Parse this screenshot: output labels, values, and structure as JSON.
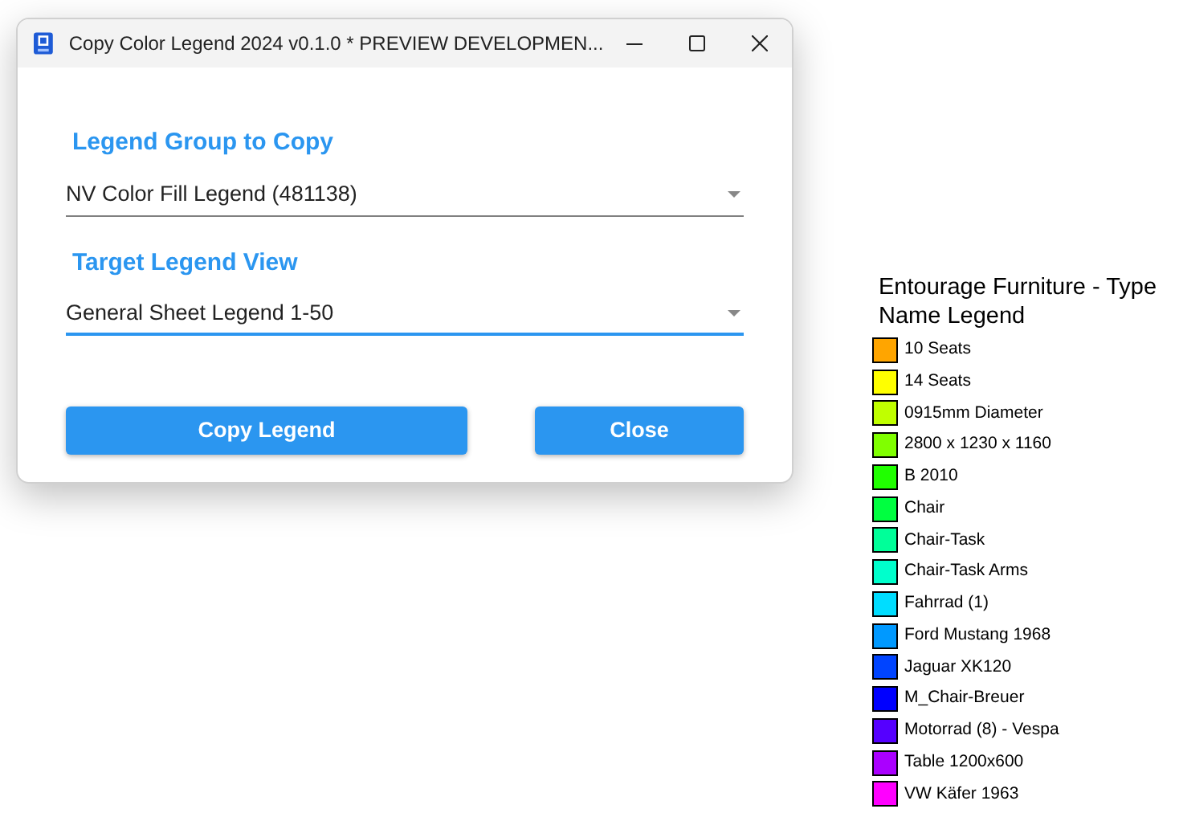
{
  "window": {
    "title": "Copy Color Legend 2024 v0.1.0 * PREVIEW DEVELOPMEN..."
  },
  "fields": [
    {
      "label": "Legend Group to Copy",
      "value": "NV Color Fill Legend (481138)",
      "focused": false
    },
    {
      "label": "Target Legend View",
      "value": "General Sheet Legend 1-50",
      "focused": true
    }
  ],
  "buttons": [
    "Copy Legend",
    "Close"
  ],
  "legend": {
    "title": "Entourage Furniture - Type Name Legend",
    "items": [
      {
        "label": "10 Seats",
        "color": "#ffa500"
      },
      {
        "label": "14 Seats",
        "color": "#ffff00"
      },
      {
        "label": "0915mm Diameter",
        "color": "#c0ff00"
      },
      {
        "label": "2800 x 1230 x 1160",
        "color": "#80ff00"
      },
      {
        "label": "B 2010",
        "color": "#20ff00"
      },
      {
        "label": "Chair",
        "color": "#00ff40"
      },
      {
        "label": "Chair-Task",
        "color": "#00ff99"
      },
      {
        "label": "Chair-Task Arms",
        "color": "#00ffcc"
      },
      {
        "label": "Fahrrad (1)",
        "color": "#00ddff"
      },
      {
        "label": "Ford Mustang 1968",
        "color": "#0099ff"
      },
      {
        "label": "Jaguar XK120",
        "color": "#0044ff"
      },
      {
        "label": "M_Chair-Breuer",
        "color": "#0000ff"
      },
      {
        "label": "Motorrad (8) - Vespa",
        "color": "#5500ff"
      },
      {
        "label": "Table 1200x600",
        "color": "#aa00ff"
      },
      {
        "label": "VW Käfer 1963",
        "color": "#ff00ff"
      }
    ]
  }
}
